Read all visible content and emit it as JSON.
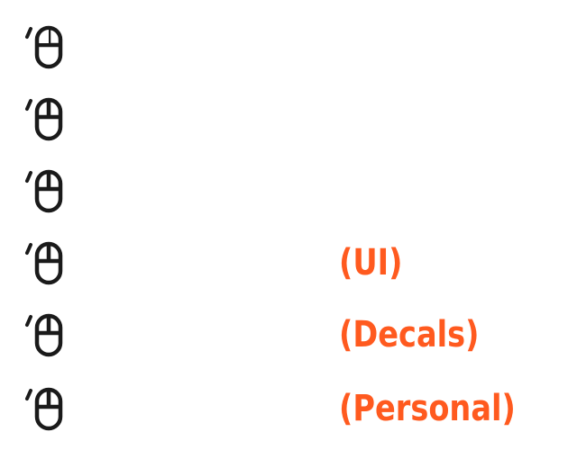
{
  "colors": {
    "icon": "#1a1a1a",
    "accent": "#ff5a1f",
    "background": "#ffffff"
  },
  "rows": [
    {
      "icon": "mouse-left-click-icon",
      "label": ""
    },
    {
      "icon": "mouse-left-click-icon",
      "label": ""
    },
    {
      "icon": "mouse-left-click-icon",
      "label": ""
    },
    {
      "icon": "mouse-left-click-icon",
      "label": "(UI)"
    },
    {
      "icon": "mouse-left-click-icon",
      "label": "(Decals)"
    },
    {
      "icon": "mouse-left-click-icon",
      "label": "(Personal)"
    }
  ]
}
